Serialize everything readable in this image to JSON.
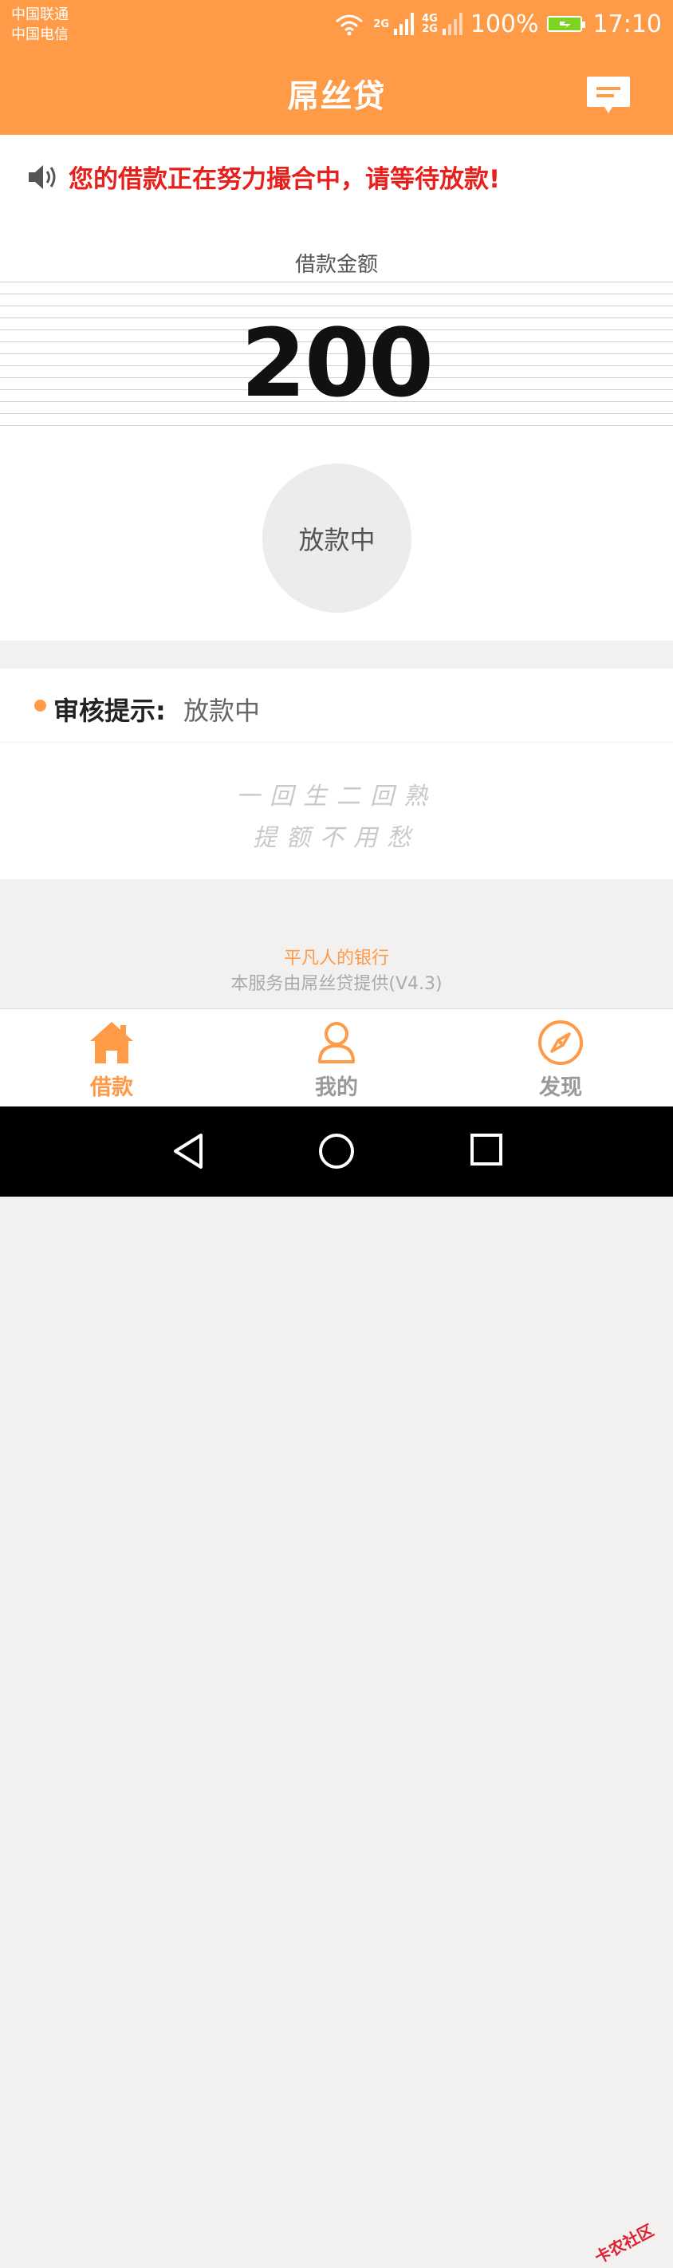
{
  "status_bar": {
    "carrier_1": "中国联通",
    "carrier_2": "中国电信",
    "net_tag_1": "2G",
    "net_tag_2_top": "4G",
    "net_tag_2_bottom": "2G",
    "battery_percent": "100%",
    "time": "17:10"
  },
  "header": {
    "title": "屌丝贷",
    "message_icon": "message-icon"
  },
  "notice": {
    "icon": "speaker-icon",
    "text": "您的借款正在努力撮合中，请等待放款!"
  },
  "loan": {
    "amount_label": "借款金额",
    "amount_value": "200",
    "status_button": "放款中"
  },
  "review": {
    "label": "审核提示:",
    "value": "放款中"
  },
  "slogan": {
    "line_1": "一回生二回熟",
    "line_2": "提额不用愁"
  },
  "footer": {
    "brand": "平凡人的银行",
    "note": "本服务由屌丝贷提供(V4.3)"
  },
  "tabbar": {
    "tabs": [
      {
        "label": "借款",
        "icon": "home-icon",
        "active": true
      },
      {
        "label": "我的",
        "icon": "user-icon",
        "active": false
      },
      {
        "label": "发现",
        "icon": "compass-icon",
        "active": false
      }
    ]
  },
  "watermark": "卡农社区",
  "colors": {
    "accent": "#ff9a47",
    "notice_red": "#e8201c"
  }
}
